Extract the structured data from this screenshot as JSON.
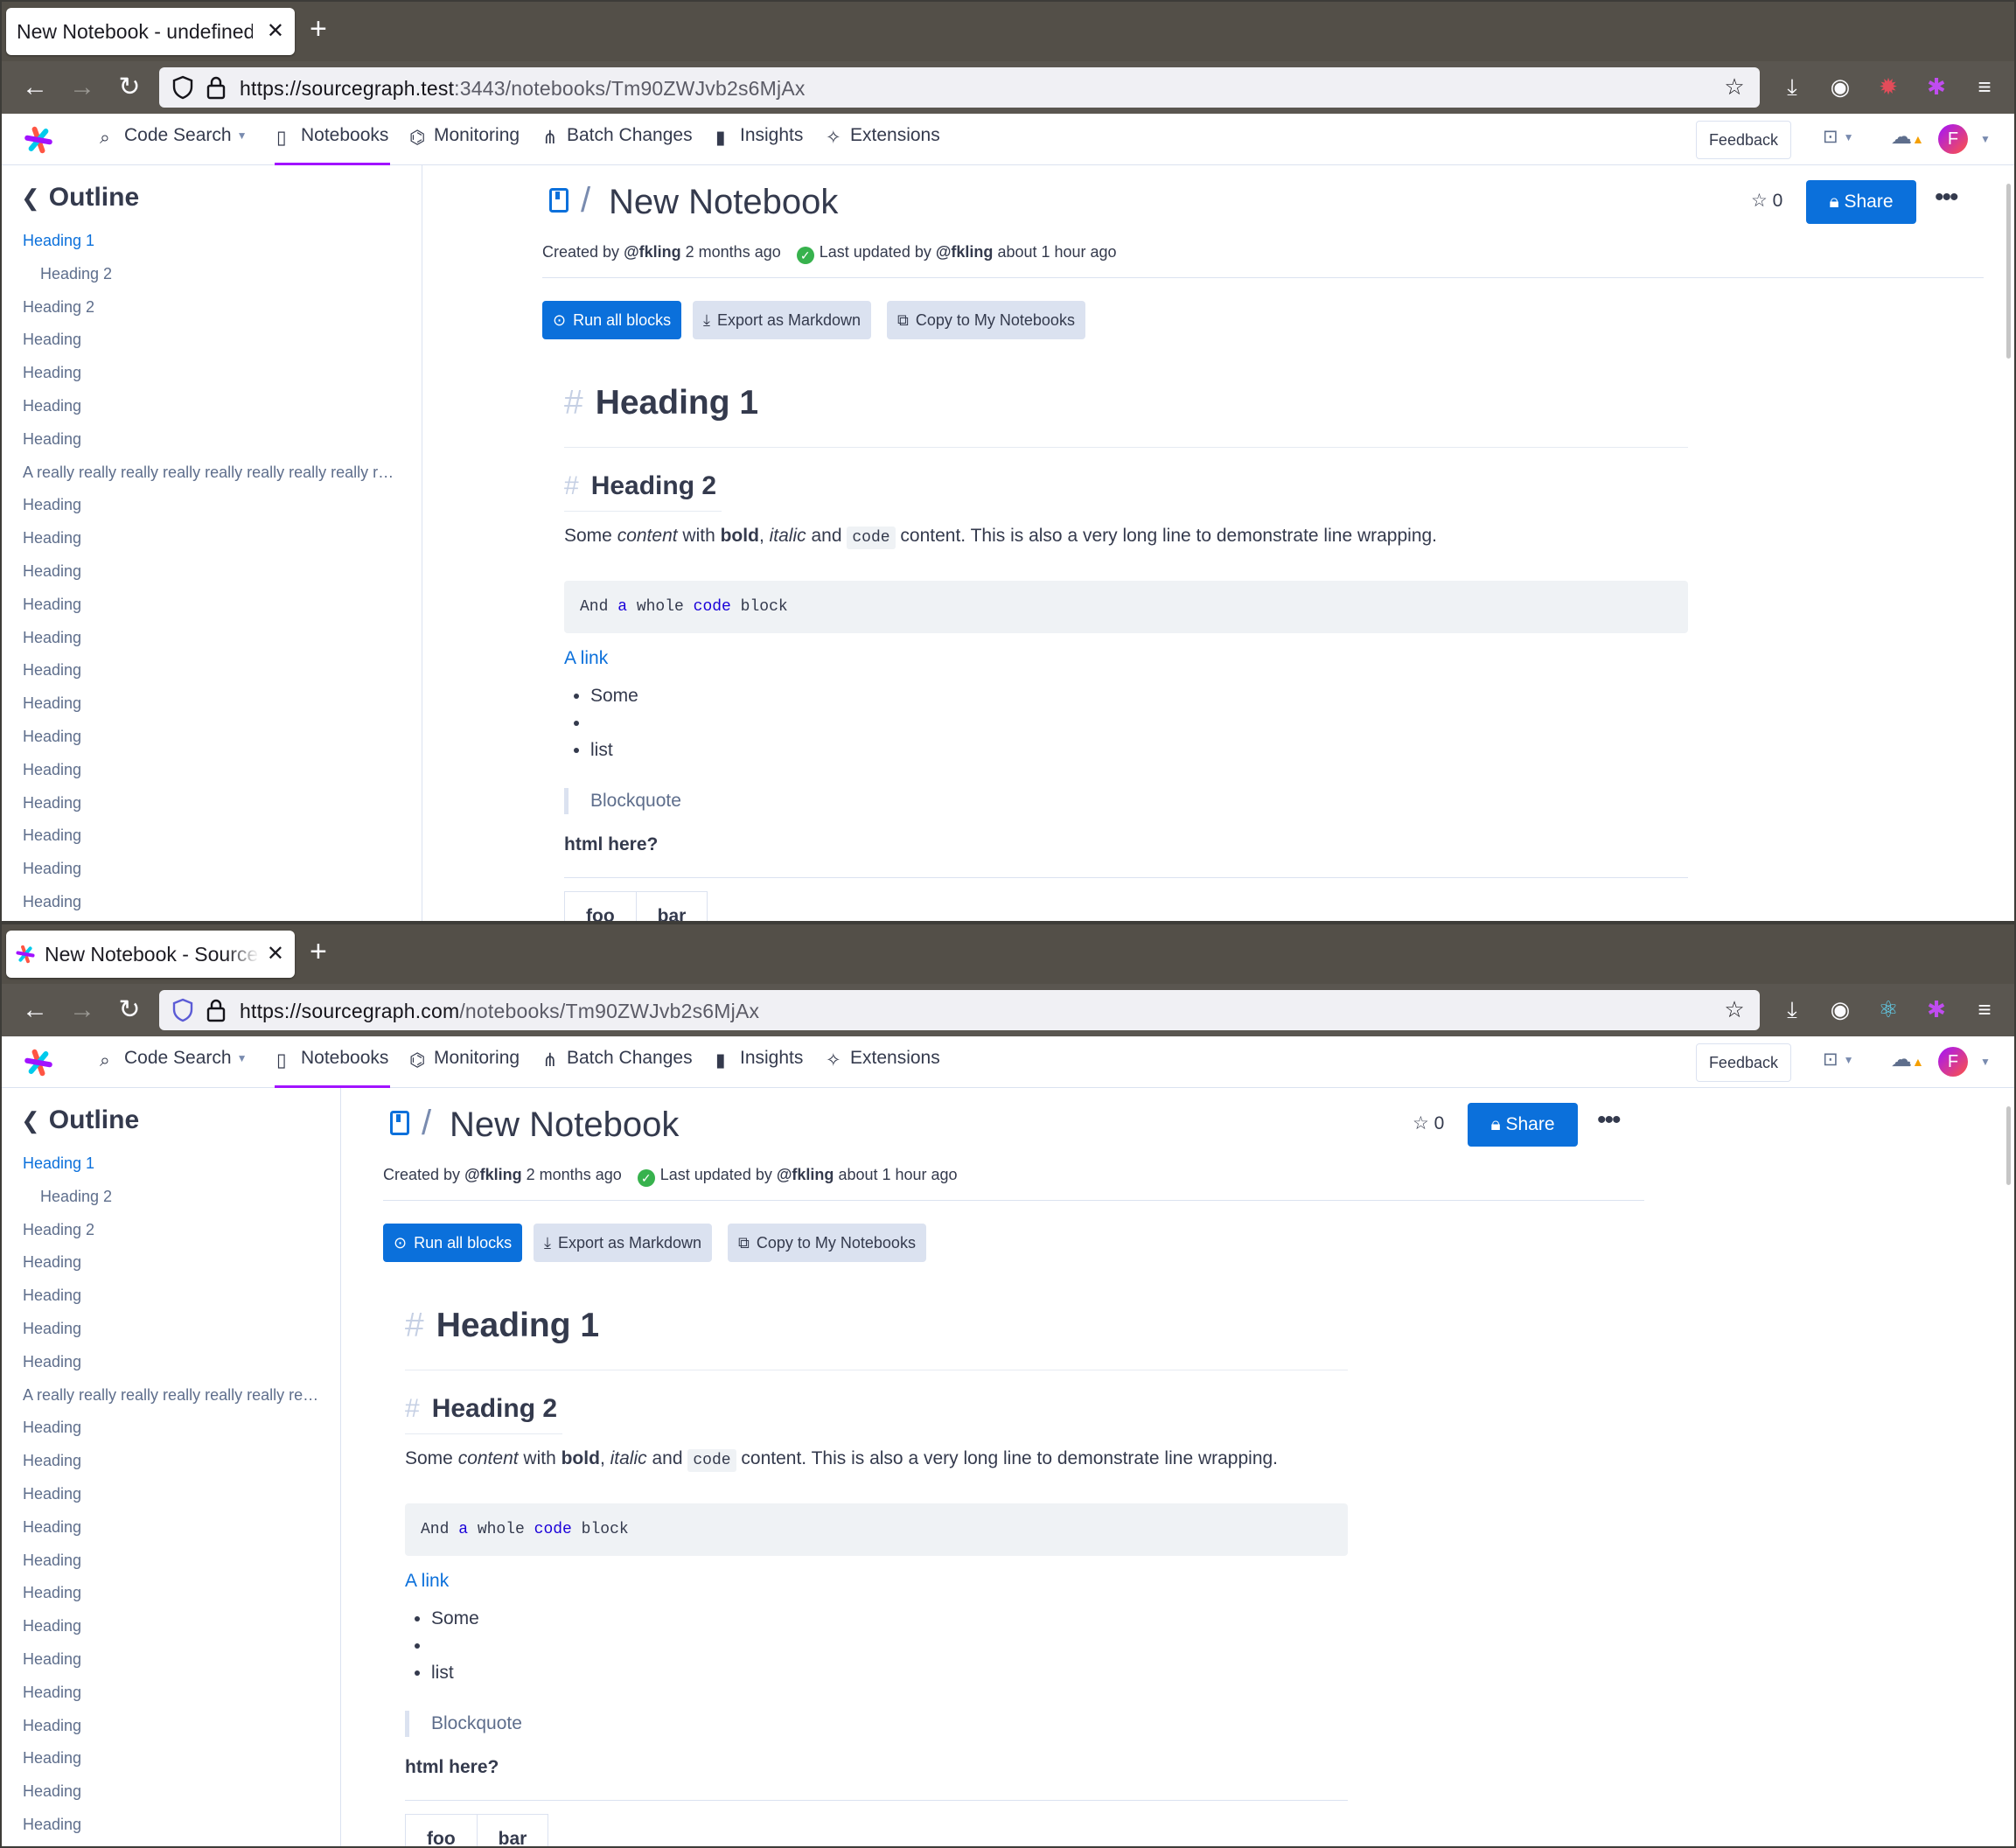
{
  "windows": [
    {
      "tab_title": "New Notebook - undefined",
      "url_host": "https://sourcegraph.test",
      "url_rest": ":3443/notebooks/Tm90ZWJvb2s6MjAx"
    },
    {
      "tab_title": "New Notebook - Sourcegraph",
      "url_host": "https://sourcegraph.com",
      "url_rest": "/notebooks/Tm90ZWJvb2s6MjAx"
    }
  ],
  "nav": {
    "code_search": "Code Search",
    "notebooks": "Notebooks",
    "monitoring": "Monitoring",
    "batch_changes": "Batch Changes",
    "insights": "Insights",
    "extensions": "Extensions",
    "feedback": "Feedback",
    "avatar_initial": "F"
  },
  "outline": {
    "title": "Outline",
    "items": [
      {
        "label": "Heading 1"
      },
      {
        "label": "Heading 2"
      },
      {
        "label": "Heading 2"
      },
      {
        "label": "Heading"
      },
      {
        "label": "Heading"
      },
      {
        "label": "Heading"
      },
      {
        "label": "Heading"
      },
      {
        "label": "A really really really really really really really really really long heading"
      },
      {
        "label": "Heading"
      },
      {
        "label": "Heading"
      },
      {
        "label": "Heading"
      },
      {
        "label": "Heading"
      },
      {
        "label": "Heading"
      },
      {
        "label": "Heading"
      },
      {
        "label": "Heading"
      },
      {
        "label": "Heading"
      },
      {
        "label": "Heading"
      },
      {
        "label": "Heading"
      },
      {
        "label": "Heading"
      },
      {
        "label": "Heading"
      },
      {
        "label": "Heading"
      }
    ]
  },
  "notebook": {
    "slash": "/",
    "title": "New Notebook",
    "created_prefix": "Created by",
    "author": "@fkling",
    "created_ago": "2 months ago",
    "updated_prefix": "Last updated by",
    "updated_by": "@fkling",
    "updated_ago": "about 1 hour ago",
    "star_count": "0",
    "share": "Share",
    "run_all": "Run all blocks",
    "export": "Export as Markdown",
    "copy": "Copy to My Notebooks"
  },
  "markdown": {
    "h1": "Heading 1",
    "h2": "Heading 2",
    "p_some": "Some ",
    "p_content": "content",
    "p_with": " with ",
    "p_bold": "bold",
    "p_comma": ", ",
    "p_italic": "italic",
    "p_and": " and ",
    "p_code": "code",
    "p_rest": " content. This is also a very long line to demonstrate line wrapping.",
    "code_and": "And ",
    "code_a": "a",
    "code_whole": " whole ",
    "code_code": "code",
    "code_block": " block",
    "link": "A link",
    "list": [
      "Some",
      "",
      "list"
    ],
    "quote": "Blockquote",
    "html_bold": "html here?",
    "table_headers": [
      "foo",
      "bar"
    ]
  },
  "colors": {
    "accent": "#0b70db",
    "active_nav": "#a112ff",
    "titlebar": "#534f48"
  }
}
